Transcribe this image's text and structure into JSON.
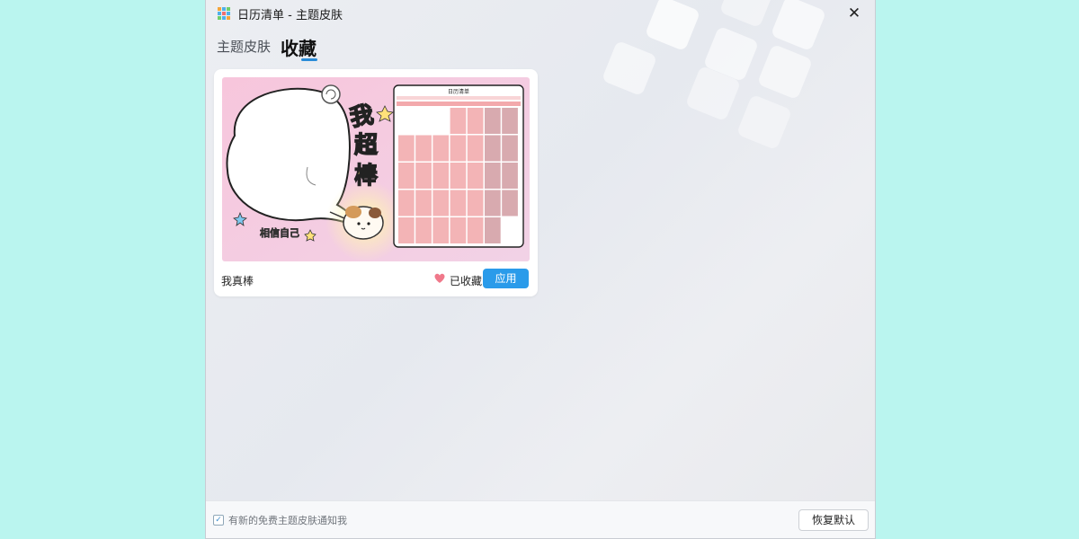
{
  "window": {
    "title": "日历清单 - 主题皮肤",
    "app_icon": "app-grid-icon",
    "close_icon": "close-icon",
    "close_glyph": "✕"
  },
  "tabs": [
    {
      "label": "主题皮肤",
      "active": false
    },
    {
      "label": "收藏",
      "active": true
    }
  ],
  "skin_card": {
    "name": "我真棒",
    "favorite_label": "已收藏",
    "favorite_icon": "heart-icon",
    "apply_label": "应用",
    "preview": {
      "slogan_chars": [
        "我",
        "超",
        "棒"
      ],
      "caption": "相信自己",
      "calendar_title": "日历清单"
    }
  },
  "footer": {
    "notify_label": "有新的免费主题皮肤通知我",
    "notify_checked": true,
    "restore_label": "恢复默认"
  },
  "colors": {
    "accent": "#2a9bea",
    "heart": "#f0788a",
    "preview_bg": "#f9c8df",
    "calendar_cell": "#f3b4b6"
  }
}
